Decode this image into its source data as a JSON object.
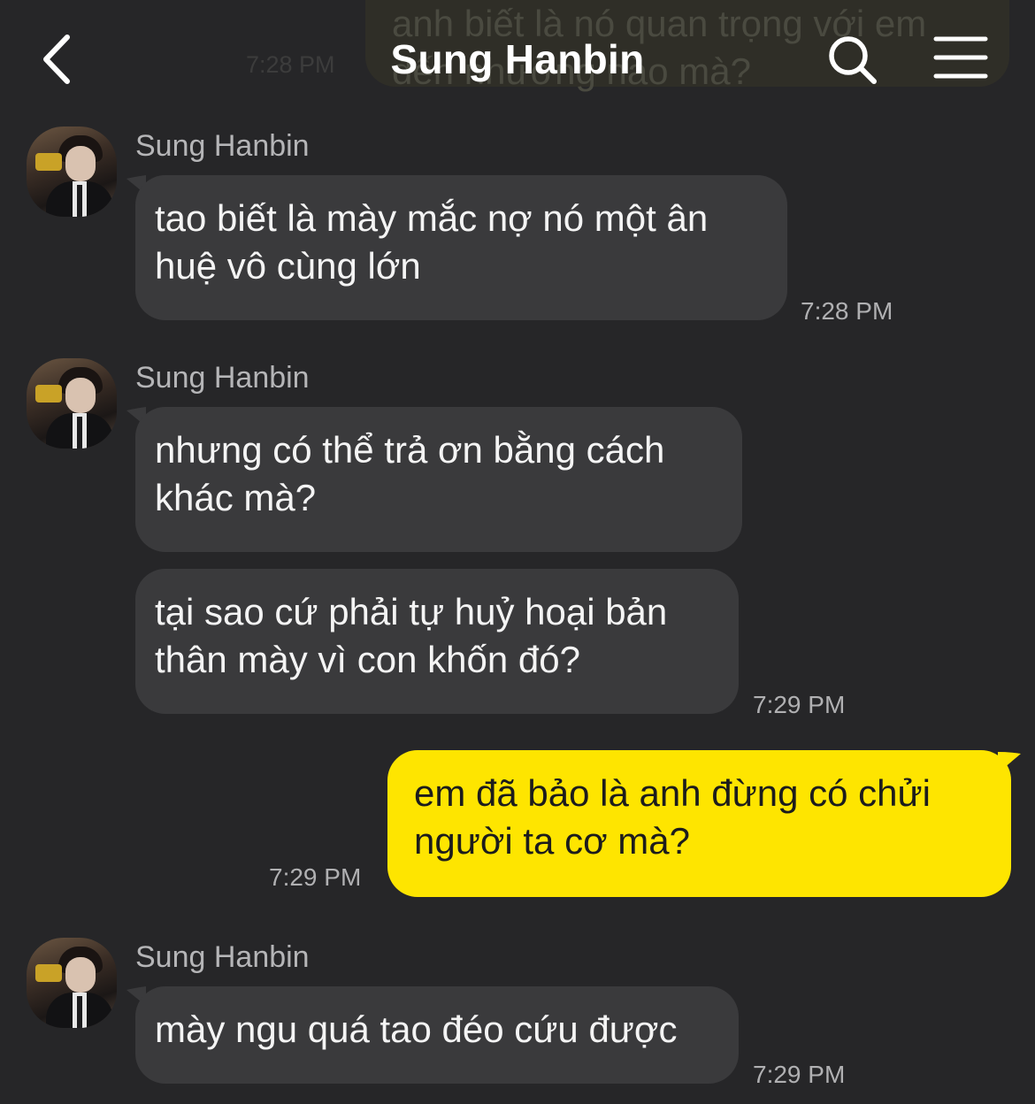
{
  "header": {
    "title": "Sung Hanbin"
  },
  "ghost": {
    "text": "anh biết là nó quan trọng với em\nđến nhường nào mà?",
    "time": "7:28 PM"
  },
  "messages": [
    {
      "sender": "Sung Hanbin",
      "bubbles": [
        "tao biết là mày mắc nợ nó một ân\nhuệ vô cùng lớn"
      ],
      "time": "7:28 PM"
    },
    {
      "sender": "Sung Hanbin",
      "bubbles": [
        "nhưng có thể trả ơn bằng cách\nkhác mà?",
        "tại sao cứ phải tự huỷ hoại bản\nthân mày vì con khốn đó?"
      ],
      "time": "7:29 PM"
    },
    {
      "outgoing": true,
      "bubbles": [
        "em đã bảo là anh đừng có chửi\nngười ta cơ mà?"
      ],
      "time": "7:29 PM"
    },
    {
      "sender": "Sung Hanbin",
      "bubbles": [
        "mày ngu quá tao đéo cứu được"
      ],
      "time": "7:29 PM"
    }
  ],
  "colors": {
    "background": "#262628",
    "incoming_bubble": "#3a3a3c",
    "outgoing_bubble": "#fee500"
  },
  "icons": {
    "back": "chevron-left-icon",
    "search": "search-icon",
    "menu": "hamburger-menu-icon"
  }
}
